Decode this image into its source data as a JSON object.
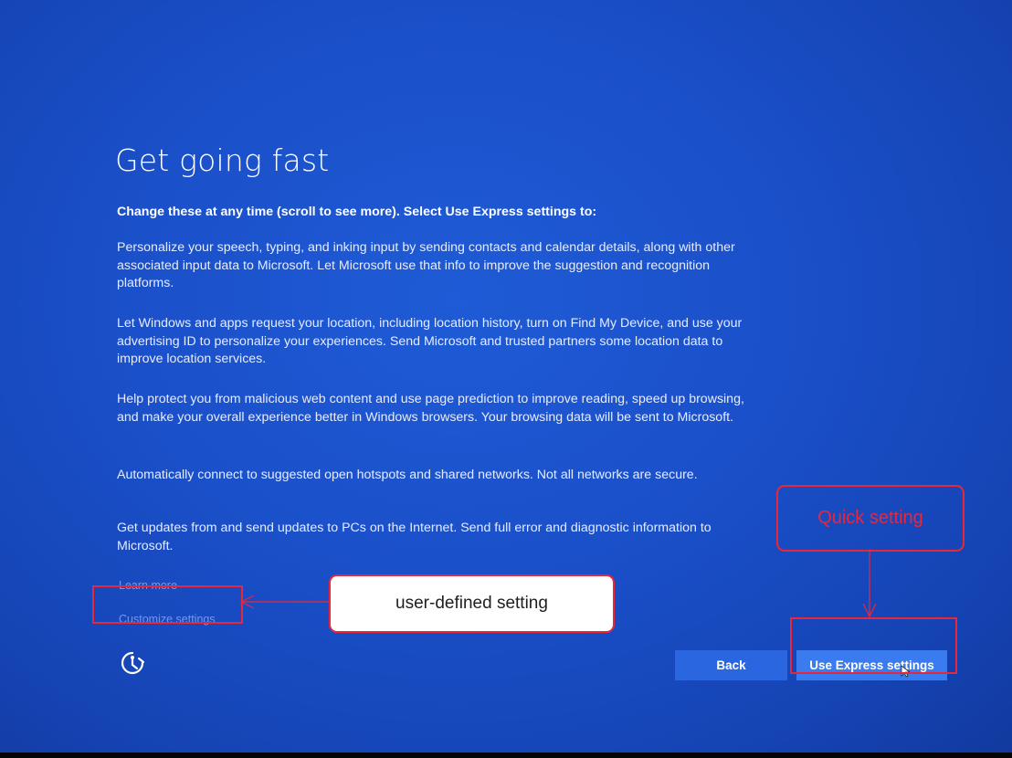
{
  "setup": {
    "title": "Get going fast",
    "subtitle": "Change these at any time (scroll to see more). Select Use Express settings to:",
    "paragraphs": [
      "Personalize your speech, typing, and inking input by sending contacts and calendar details, along with other associated input data to Microsoft. Let Microsoft use that info to improve the suggestion and recognition platforms.",
      "Let Windows and apps request your location, including location history, turn on Find My Device, and use your advertising ID to personalize your experiences. Send Microsoft and trusted partners some location data to improve location services.",
      "Help protect you from malicious web content and use page prediction to improve reading, speed up browsing, and make your overall experience better in Windows browsers. Your browsing data will be sent to Microsoft.",
      "Automatically connect to suggested open hotspots and shared networks. Not all networks are secure.",
      "Get updates from and send updates to PCs on the Internet. Send full error and diagnostic information to Microsoft."
    ],
    "learn_more_label": "Learn more",
    "customize_label": "Customize settings",
    "back_label": "Back",
    "express_label": "Use Express settings",
    "accessibility_icon": "ease-of-access-icon"
  },
  "annotations": {
    "quick_label": "Quick setting",
    "user_defined_label": "user-defined setting",
    "color": "#e8283a"
  },
  "colors": {
    "background": "#1a4fc8",
    "back_button": "#2a66e0",
    "express_button": "#3a7cf0"
  }
}
